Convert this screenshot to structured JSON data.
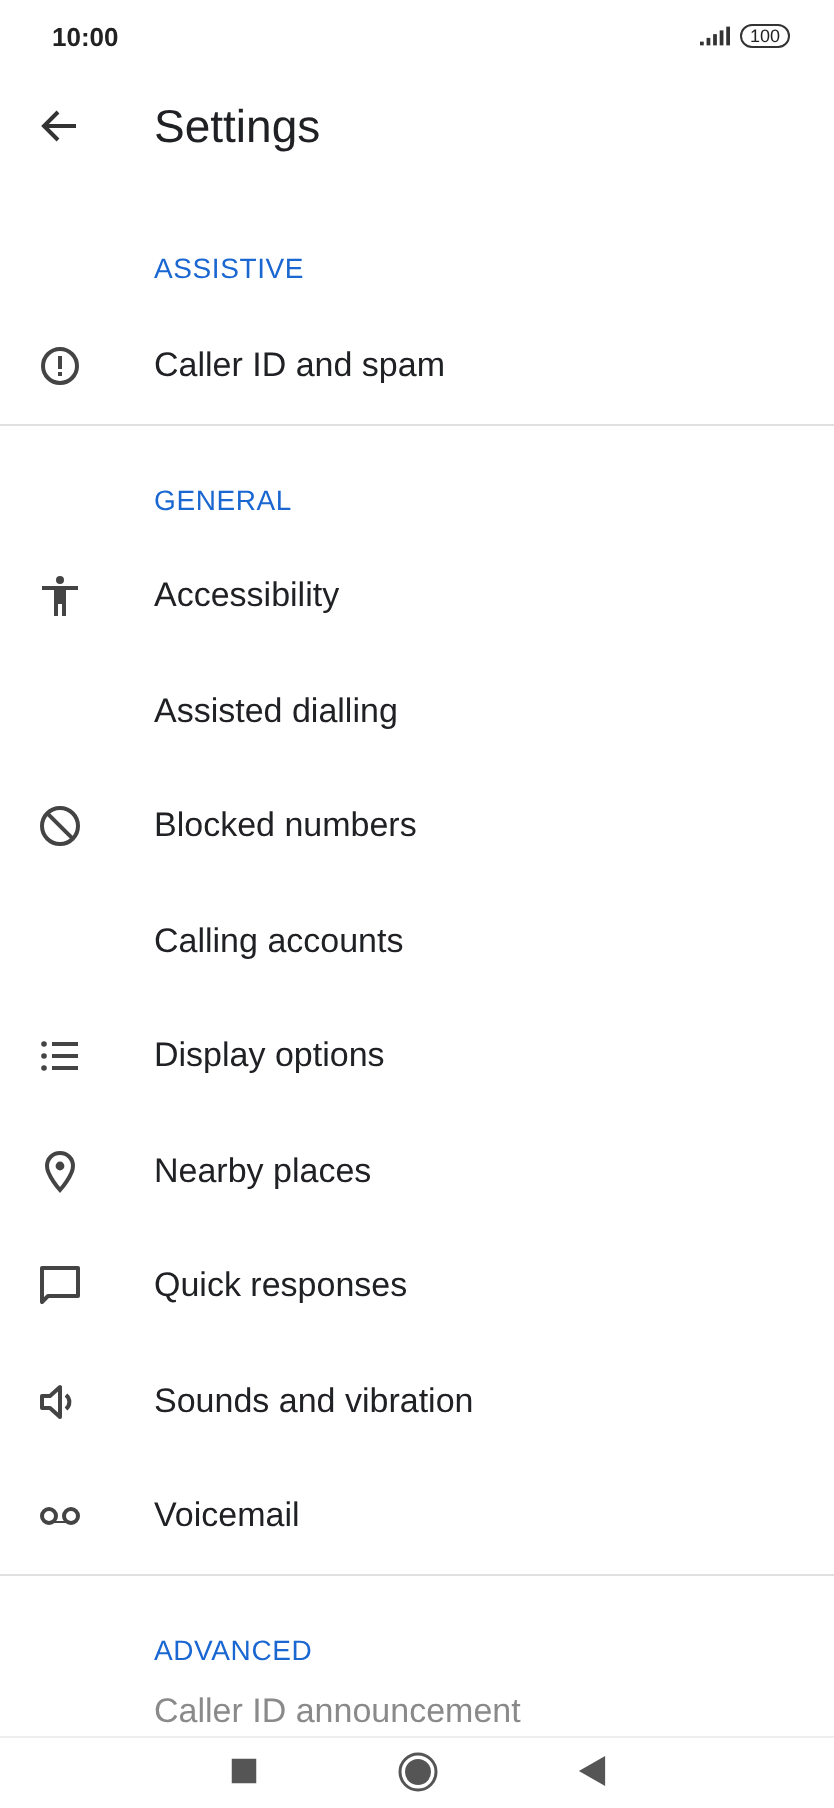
{
  "status_bar": {
    "time": "10:00",
    "battery": "100"
  },
  "header": {
    "title": "Settings"
  },
  "sections": [
    {
      "title": "ASSISTIVE",
      "items": [
        {
          "label": "Caller ID and spam",
          "kind": "alert"
        }
      ]
    },
    {
      "title": "GENERAL",
      "items": [
        {
          "label": "Accessibility",
          "kind": "accessibility"
        },
        {
          "label": "Assisted dialling",
          "kind": "plain"
        },
        {
          "label": "Blocked numbers",
          "kind": "block"
        },
        {
          "label": "Calling accounts",
          "kind": "plain"
        },
        {
          "label": "Display options",
          "kind": "list"
        },
        {
          "label": "Nearby places",
          "kind": "place"
        },
        {
          "label": "Quick responses",
          "kind": "chat"
        },
        {
          "label": "Sounds and vibration",
          "kind": "volume"
        },
        {
          "label": "Voicemail",
          "kind": "voicemail"
        }
      ]
    },
    {
      "title": "ADVANCED",
      "items": [
        {
          "label": "Caller ID announcement",
          "kind": "plain"
        }
      ]
    }
  ]
}
